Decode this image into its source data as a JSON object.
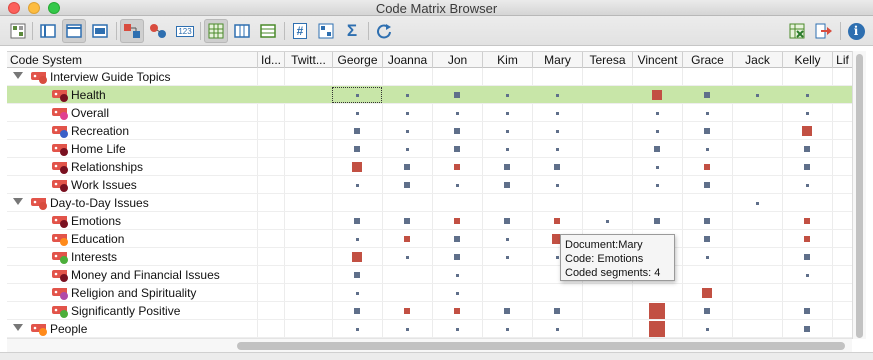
{
  "window": {
    "title": "Code Matrix Browser"
  },
  "toolbar": {
    "left_icons": [
      "matrix-icon",
      "rows-icon",
      "columns-icon",
      "window-icon",
      "codes-squares-icon",
      "codes-circles-icon",
      "numbers-icon",
      "table-grid-icon",
      "split-columns-icon",
      "list-icon",
      "hash-icon",
      "numbered-icon",
      "sum-icon",
      "refresh-icon"
    ],
    "right_icons": [
      "excel-export-icon",
      "export-icon",
      "info-icon"
    ],
    "sum_glyph": "Σ",
    "hash_glyph": "#",
    "numbers_glyph": "123",
    "info_glyph": "i"
  },
  "table": {
    "row_header": "Code System",
    "columns": [
      "Id...",
      "Twitt...",
      "George",
      "Joanna",
      "Jon",
      "Kim",
      "Mary",
      "Teresa",
      "Vincent",
      "Grace",
      "Jack",
      "Kelly",
      "Lif"
    ],
    "rows": [
      {
        "label": "Interview Guide Topics",
        "level": 0,
        "expanded": true,
        "dot": "#d84c3e",
        "cells": []
      },
      {
        "label": "Health",
        "level": 1,
        "dot": "#7a1020",
        "selected": true,
        "focus": "George",
        "cells": [
          [
            "George",
            1
          ],
          [
            "Joanna",
            1
          ],
          [
            "Jon",
            2
          ],
          [
            "Kim",
            1
          ],
          [
            "Mary",
            1
          ],
          [
            "Vincent",
            3,
            "r"
          ],
          [
            "Grace",
            2
          ],
          [
            "Jack",
            1
          ],
          [
            "Kelly",
            1
          ]
        ]
      },
      {
        "label": "Overall",
        "level": 1,
        "dot": "#e04090",
        "cells": [
          [
            "George",
            1
          ],
          [
            "Joanna",
            1
          ],
          [
            "Jon",
            1
          ],
          [
            "Kim",
            1
          ],
          [
            "Mary",
            1
          ],
          [
            "Vincent",
            1
          ],
          [
            "Grace",
            1
          ],
          [
            "Kelly",
            1
          ]
        ]
      },
      {
        "label": "Recreation",
        "level": 1,
        "dot": "#3a60c8",
        "cells": [
          [
            "George",
            2
          ],
          [
            "Joanna",
            1
          ],
          [
            "Jon",
            2
          ],
          [
            "Kim",
            1
          ],
          [
            "Mary",
            1
          ],
          [
            "Vincent",
            1
          ],
          [
            "Grace",
            2
          ],
          [
            "Kelly",
            3,
            "r"
          ]
        ]
      },
      {
        "label": "Home Life",
        "level": 1,
        "dot": "#7a1020",
        "cells": [
          [
            "George",
            2
          ],
          [
            "Joanna",
            1
          ],
          [
            "Jon",
            2
          ],
          [
            "Kim",
            1
          ],
          [
            "Mary",
            1
          ],
          [
            "Vincent",
            2
          ],
          [
            "Grace",
            1
          ],
          [
            "Kelly",
            2
          ]
        ]
      },
      {
        "label": "Relationships",
        "level": 1,
        "dot": "#7a1020",
        "cells": [
          [
            "George",
            3,
            "r"
          ],
          [
            "Joanna",
            2
          ],
          [
            "Jon",
            2,
            "r"
          ],
          [
            "Kim",
            2
          ],
          [
            "Mary",
            2
          ],
          [
            "Vincent",
            1
          ],
          [
            "Grace",
            2,
            "r"
          ],
          [
            "Kelly",
            2
          ]
        ]
      },
      {
        "label": "Work Issues",
        "level": 1,
        "dot": "#7a1020",
        "cells": [
          [
            "George",
            1
          ],
          [
            "Joanna",
            2
          ],
          [
            "Jon",
            1
          ],
          [
            "Kim",
            2
          ],
          [
            "Mary",
            1
          ],
          [
            "Vincent",
            1
          ],
          [
            "Grace",
            2
          ],
          [
            "Kelly",
            1
          ]
        ]
      },
      {
        "label": "Day-to-Day Issues",
        "level": 0,
        "expanded": true,
        "dot": "#d84c3e",
        "cells": [
          [
            "Jack",
            1
          ]
        ]
      },
      {
        "label": "Emotions",
        "level": 1,
        "dot": "#7a1020",
        "cells": [
          [
            "George",
            2
          ],
          [
            "Joanna",
            2
          ],
          [
            "Jon",
            2,
            "r"
          ],
          [
            "Kim",
            2
          ],
          [
            "Mary",
            2,
            "r"
          ],
          [
            "Teresa",
            1
          ],
          [
            "Vincent",
            2
          ],
          [
            "Grace",
            2
          ],
          [
            "Kelly",
            2,
            "r"
          ]
        ]
      },
      {
        "label": "Education",
        "level": 1,
        "dot": "#ff8a1a",
        "cells": [
          [
            "George",
            1
          ],
          [
            "Joanna",
            2,
            "r"
          ],
          [
            "Jon",
            2
          ],
          [
            "Kim",
            1
          ],
          [
            "Mary",
            3,
            "r"
          ],
          [
            "Vincent",
            2
          ],
          [
            "Grace",
            2
          ],
          [
            "Kelly",
            2,
            "r"
          ]
        ]
      },
      {
        "label": "Interests",
        "level": 1,
        "dot": "#4cae3a",
        "cells": [
          [
            "George",
            3,
            "r"
          ],
          [
            "Joanna",
            1
          ],
          [
            "Jon",
            2
          ],
          [
            "Kim",
            1
          ],
          [
            "Mary",
            1
          ],
          [
            "Vincent",
            1
          ],
          [
            "Grace",
            1
          ],
          [
            "Kelly",
            2
          ]
        ]
      },
      {
        "label": "Money and Financial Issues",
        "level": 1,
        "dot": "#7a1020",
        "cells": [
          [
            "George",
            2
          ],
          [
            "Jon",
            1
          ],
          [
            "Kelly",
            1
          ]
        ]
      },
      {
        "label": "Religion and Spirituality",
        "level": 1,
        "dot": "#b04aa8",
        "cells": [
          [
            "George",
            1
          ],
          [
            "Jon",
            1
          ],
          [
            "Grace",
            3,
            "r"
          ]
        ]
      },
      {
        "label": "Significantly Positive",
        "level": 1,
        "dot": "#4cae3a",
        "cells": [
          [
            "George",
            2
          ],
          [
            "Joanna",
            2,
            "r"
          ],
          [
            "Jon",
            2,
            "r"
          ],
          [
            "Kim",
            2
          ],
          [
            "Mary",
            2
          ],
          [
            "Vincent",
            4,
            "r"
          ],
          [
            "Grace",
            2
          ],
          [
            "Kelly",
            2
          ]
        ]
      },
      {
        "label": "People",
        "level": 0,
        "expanded": true,
        "dot": "#ff8a1a",
        "cells": [
          [
            "George",
            1
          ],
          [
            "Joanna",
            1
          ],
          [
            "Jon",
            1
          ],
          [
            "Kim",
            1
          ],
          [
            "Mary",
            1
          ],
          [
            "Vincent",
            4,
            "r"
          ],
          [
            "Grace",
            1
          ],
          [
            "Kelly",
            2
          ]
        ]
      }
    ]
  },
  "tooltip": {
    "line1": "Document:Mary",
    "line2": "Code: Emotions",
    "line3": "Coded segments: 4"
  },
  "colors": {
    "square_small": "#5f6f8a",
    "square_red": "#c25043",
    "selected_row": "#c8e6a8",
    "code_tag": "#e2544a"
  }
}
